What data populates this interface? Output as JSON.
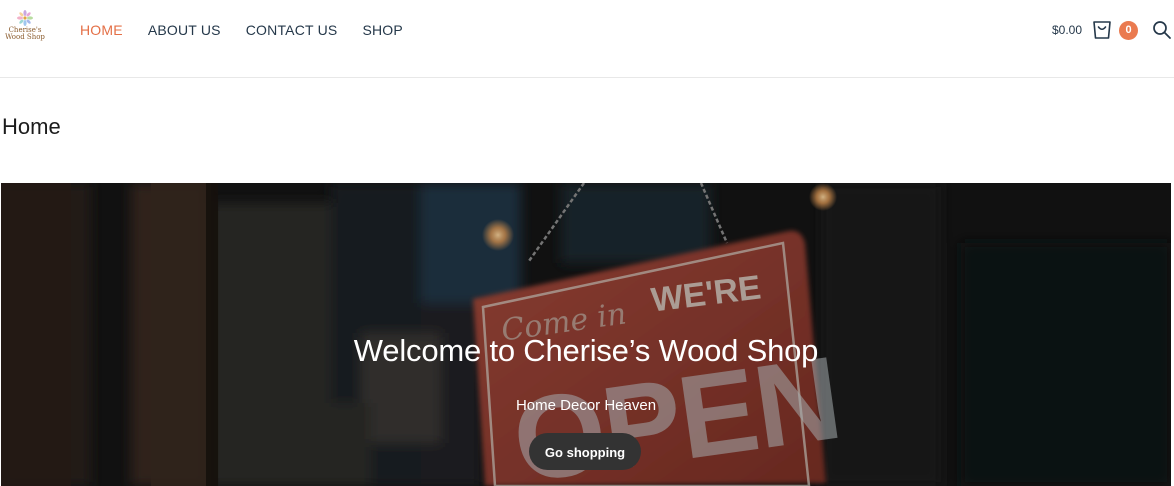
{
  "header": {
    "logo": {
      "text": "Cherise's\nWood Shop"
    },
    "nav": [
      {
        "label": "HOME"
      },
      {
        "label": "ABOUT US"
      },
      {
        "label": "CONTACT US"
      },
      {
        "label": "SHOP"
      }
    ],
    "cart": {
      "total": "$0.00",
      "count": "0",
      "icon": "cart-icon"
    },
    "search": {
      "icon": "search-icon"
    }
  },
  "page": {
    "title": "Home"
  },
  "hero": {
    "title": "Welcome to Cherise’s Wood Shop",
    "subtitle": "Home Decor Heaven",
    "button_label": "Go shopping",
    "sign": {
      "line1": "Come in",
      "line2": "WE'RE",
      "line3": "OPEN"
    }
  },
  "colors": {
    "accent": "#e46f46",
    "nav_text": "#25384a",
    "badge": "#ea7a4f",
    "button_bg": "#333333"
  }
}
